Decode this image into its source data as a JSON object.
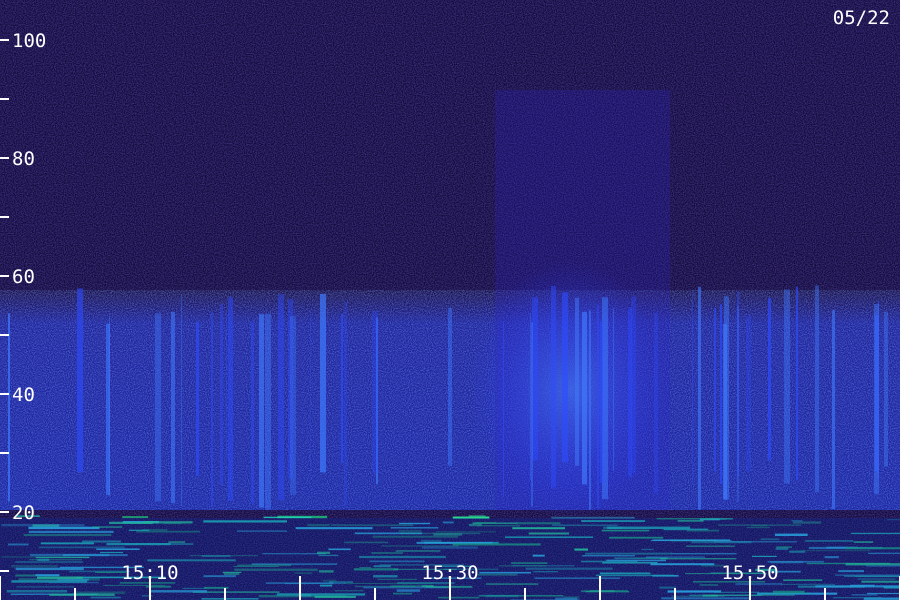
{
  "chart_data": {
    "type": "heatmap",
    "date_label": "05/22",
    "ylim": [
      0,
      100
    ],
    "y_ticks_major": [
      20,
      40,
      60,
      80,
      100
    ],
    "y_ticks_minor": [
      10,
      30,
      50,
      70,
      90
    ],
    "x_tick_labels": [
      "15:10",
      "15:30",
      "15:50"
    ],
    "colors": {
      "background": "#120a3a",
      "low": "#1a0c6a",
      "mid": "#2a2aff",
      "high": "#4aa0ff",
      "peak": "#2cff9a",
      "axis": "#ffffff"
    }
  }
}
